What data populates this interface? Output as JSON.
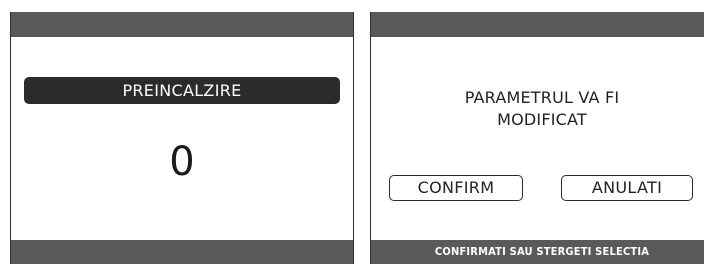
{
  "left_screen": {
    "title": "PREINCALZIRE",
    "value": "0"
  },
  "right_screen": {
    "message_line1": "PARAMETRUL VA FI",
    "message_line2": "MODIFICAT",
    "confirm_label": "CONFIRM",
    "cancel_label": "ANULATI",
    "footer": "CONFIRMATI SAU STERGETI SELECTIA"
  },
  "colors": {
    "bar": "#5a5a5a",
    "pill": "#2b2b2b",
    "background": "#ffffff",
    "text": "#222222"
  }
}
